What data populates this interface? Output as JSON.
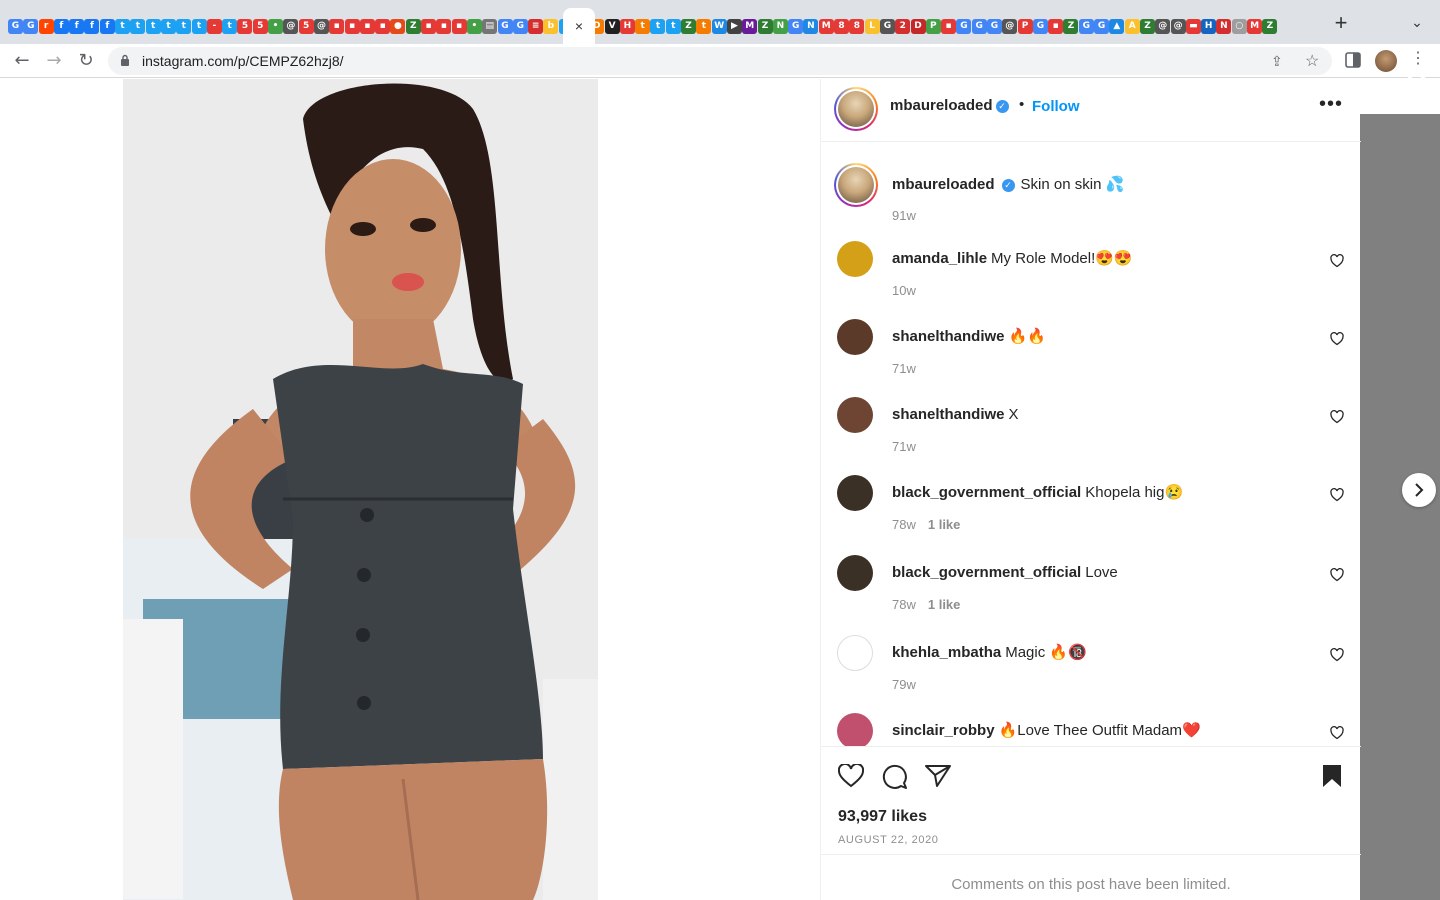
{
  "browser": {
    "url": "instagram.com/p/CEMPZ62hzj8/",
    "active_tab_close": "×",
    "new_tab": "+",
    "tab_menu": "⌄"
  },
  "tabs": [
    {
      "glyph": "G",
      "color": "#4285f4"
    },
    {
      "glyph": "G",
      "color": "#4285f4"
    },
    {
      "glyph": "r",
      "color": "#ff4500"
    },
    {
      "glyph": "f",
      "color": "#1877f2"
    },
    {
      "glyph": "f",
      "color": "#1877f2"
    },
    {
      "glyph": "f",
      "color": "#1877f2"
    },
    {
      "glyph": "f",
      "color": "#1877f2"
    },
    {
      "glyph": "t",
      "color": "#1da1f2"
    },
    {
      "glyph": "t",
      "color": "#1da1f2"
    },
    {
      "glyph": "t",
      "color": "#1da1f2"
    },
    {
      "glyph": "t",
      "color": "#1da1f2"
    },
    {
      "glyph": "t",
      "color": "#1da1f2"
    },
    {
      "glyph": "t",
      "color": "#1da1f2"
    },
    {
      "glyph": "-",
      "color": "#e53935"
    },
    {
      "glyph": "t",
      "color": "#1da1f2"
    },
    {
      "glyph": "5",
      "color": "#e53935"
    },
    {
      "glyph": "5",
      "color": "#e53935"
    },
    {
      "glyph": "•",
      "color": "#43a047"
    },
    {
      "glyph": "@",
      "color": "#555555"
    },
    {
      "glyph": "5",
      "color": "#e53935"
    },
    {
      "glyph": "@",
      "color": "#555555"
    },
    {
      "glyph": "▪",
      "color": "#e53935"
    },
    {
      "glyph": "▪",
      "color": "#e53935"
    },
    {
      "glyph": "▪",
      "color": "#e53935"
    },
    {
      "glyph": "▪",
      "color": "#e53935"
    },
    {
      "glyph": "●",
      "color": "#e64a19"
    },
    {
      "glyph": "Z",
      "color": "#2e7d32"
    },
    {
      "glyph": "▪",
      "color": "#e53935"
    },
    {
      "glyph": "▪",
      "color": "#e53935"
    },
    {
      "glyph": "▪",
      "color": "#e53935"
    },
    {
      "glyph": "•",
      "color": "#43a047"
    },
    {
      "glyph": "▤",
      "color": "#757575"
    },
    {
      "glyph": "G",
      "color": "#4285f4"
    },
    {
      "glyph": "G",
      "color": "#4285f4"
    },
    {
      "glyph": "≡",
      "color": "#d32f2f"
    },
    {
      "glyph": "b",
      "color": "#fbc02d"
    },
    {
      "glyph": "t",
      "color": "#1da1f2"
    },
    {
      "glyph": "◎",
      "color": "#c13584"
    },
    {
      "glyph": "D",
      "color": "#f57c00"
    },
    {
      "glyph": "V",
      "color": "#212121"
    },
    {
      "glyph": "H",
      "color": "#e53935"
    },
    {
      "glyph": "t",
      "color": "#f57c00"
    },
    {
      "glyph": "t",
      "color": "#1da1f2"
    },
    {
      "glyph": "t",
      "color": "#1da1f2"
    },
    {
      "glyph": "Z",
      "color": "#2e7d32"
    },
    {
      "glyph": "t",
      "color": "#f57c00"
    },
    {
      "glyph": "W",
      "color": "#1e88e5"
    },
    {
      "glyph": "▶",
      "color": "#424242"
    },
    {
      "glyph": "M",
      "color": "#6a1b9a"
    },
    {
      "glyph": "Z",
      "color": "#2e7d32"
    },
    {
      "glyph": "N",
      "color": "#43a047"
    },
    {
      "glyph": "G",
      "color": "#4285f4"
    },
    {
      "glyph": "N",
      "color": "#1e88e5"
    },
    {
      "glyph": "M",
      "color": "#e53935"
    },
    {
      "glyph": "8",
      "color": "#e53935"
    },
    {
      "glyph": "8",
      "color": "#e53935"
    },
    {
      "glyph": "L",
      "color": "#fbc02d"
    },
    {
      "glyph": "G",
      "color": "#555555"
    },
    {
      "glyph": "2",
      "color": "#d32f2f"
    },
    {
      "glyph": "D",
      "color": "#c62828"
    },
    {
      "glyph": "P",
      "color": "#43a047"
    },
    {
      "glyph": "▪",
      "color": "#e53935"
    },
    {
      "glyph": "G",
      "color": "#4285f4"
    },
    {
      "glyph": "G",
      "color": "#4285f4"
    },
    {
      "glyph": "G",
      "color": "#4285f4"
    },
    {
      "glyph": "@",
      "color": "#555555"
    },
    {
      "glyph": "P",
      "color": "#e53935"
    },
    {
      "glyph": "G",
      "color": "#4285f4"
    },
    {
      "glyph": "▪",
      "color": "#e53935"
    },
    {
      "glyph": "Z",
      "color": "#2e7d32"
    },
    {
      "glyph": "G",
      "color": "#4285f4"
    },
    {
      "glyph": "G",
      "color": "#4285f4"
    },
    {
      "glyph": "▲",
      "color": "#1e88e5"
    },
    {
      "glyph": "A",
      "color": "#fbc02d"
    },
    {
      "glyph": "Z",
      "color": "#2e7d32"
    },
    {
      "glyph": "@",
      "color": "#555555"
    },
    {
      "glyph": "@",
      "color": "#555555"
    },
    {
      "glyph": "▬",
      "color": "#e53935"
    },
    {
      "glyph": "H",
      "color": "#1565c0"
    },
    {
      "glyph": "N",
      "color": "#d32f2f"
    },
    {
      "glyph": "○",
      "color": "#9e9e9e"
    },
    {
      "glyph": "M",
      "color": "#e53935"
    },
    {
      "glyph": "Z",
      "color": "#2e7d32"
    }
  ],
  "post": {
    "author": "mbaureloaded",
    "follow_label": "Follow",
    "dot": "•",
    "more": "•••",
    "caption_user": "mbaureloaded",
    "caption_text": "Skin on skin 💦",
    "caption_time": "91w",
    "likes": "93,997 likes",
    "date": "AUGUST 22, 2020",
    "limited": "Comments on this post have been limited."
  },
  "comments": [
    {
      "user": "amanda_lihle",
      "text": "My Role Model!😍😍",
      "time": "10w",
      "likes": "",
      "avatar": "#d4a017"
    },
    {
      "user": "shanelthandiwe",
      "text": "🔥🔥",
      "time": "71w",
      "likes": "",
      "avatar": "#5b3a29"
    },
    {
      "user": "shanelthandiwe",
      "text": "X",
      "time": "71w",
      "likes": "",
      "avatar": "#6d4532"
    },
    {
      "user": "black_government_official",
      "text": "Khopela hig😢",
      "time": "78w",
      "likes": "1 like",
      "avatar": "#3b3025"
    },
    {
      "user": "black_government_official",
      "text": "Love",
      "time": "78w",
      "likes": "1 like",
      "avatar": "#3b3025"
    },
    {
      "user": "khehla_mbatha",
      "text": "Magic 🔥🔞",
      "time": "79w",
      "likes": "",
      "avatar": "#ffffff"
    },
    {
      "user": "sinclair_robby",
      "text": "🔥Love Thee Outfit Madam❤️",
      "time": "",
      "likes": "",
      "avatar": "#c0506e"
    }
  ],
  "icons": {
    "back": "back-arrow-icon",
    "forward": "forward-arrow-icon",
    "reload": "reload-icon",
    "like": "heart-icon",
    "comment": "comment-icon",
    "share": "paper-plane-icon",
    "save": "bookmark-icon"
  }
}
